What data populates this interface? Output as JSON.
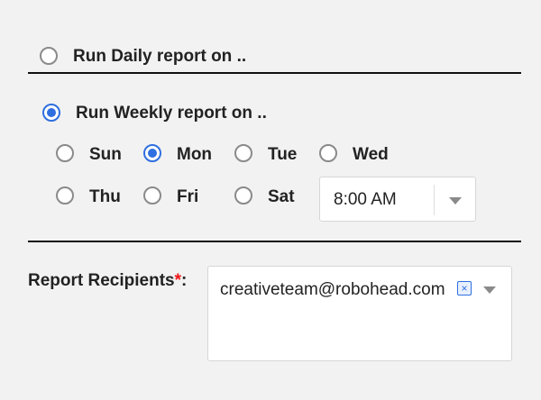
{
  "daily": {
    "label": "Run Daily report on .."
  },
  "weekly": {
    "label": "Run Weekly report on ..",
    "days": [
      "Sun",
      "Mon",
      "Tue",
      "Wed",
      "Thu",
      "Fri",
      "Sat"
    ],
    "selected_day": "Mon",
    "time_value": "8:00 AM"
  },
  "recipients": {
    "label": "Report Recipients",
    "required_mark": "*",
    "colon": ":",
    "chips": [
      {
        "email": "creativeteam@robohead.com",
        "remove_glyph": "×"
      }
    ]
  },
  "colors": {
    "accent": "#2f6fe0",
    "required": "#e11111"
  }
}
